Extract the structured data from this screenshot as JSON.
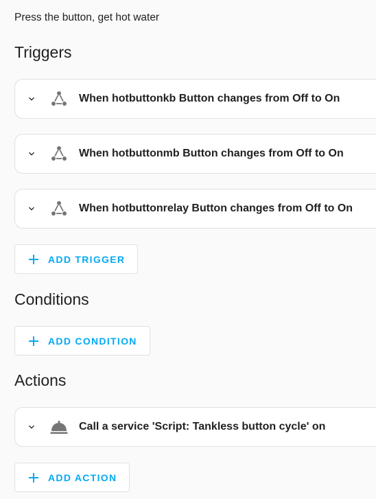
{
  "description": "Press the button, get hot water",
  "triggers": {
    "title": "Triggers",
    "items": [
      {
        "label": "When hotbuttonkb Button changes from Off to On",
        "icon": "state-trigger-icon"
      },
      {
        "label": "When hotbuttonmb Button changes from Off to On",
        "icon": "state-trigger-icon"
      },
      {
        "label": "When hotbuttonrelay Button changes from Off to On",
        "icon": "state-trigger-icon"
      }
    ],
    "add_label": "ADD TRIGGER"
  },
  "conditions": {
    "title": "Conditions",
    "add_label": "ADD CONDITION"
  },
  "actions": {
    "title": "Actions",
    "items": [
      {
        "label": "Call a service 'Script: Tankless button cycle' on",
        "icon": "service-bell-icon"
      }
    ],
    "add_label": "ADD ACTION"
  },
  "colors": {
    "accent": "#03a9f4",
    "icon": "#757575",
    "text": "#212121",
    "background": "#fafafa",
    "card_border": "#e0e0e0"
  }
}
